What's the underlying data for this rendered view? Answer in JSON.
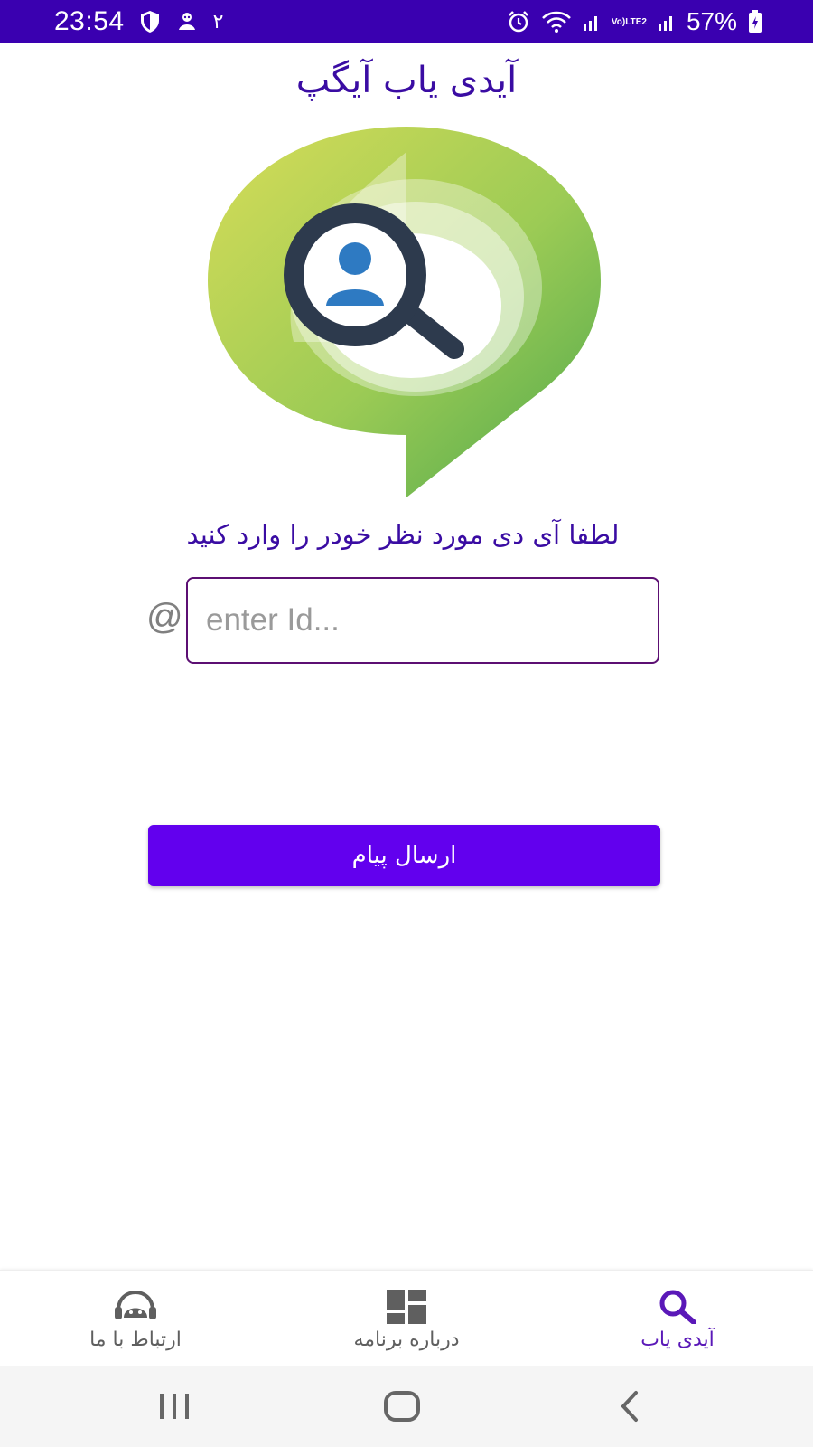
{
  "status_bar": {
    "time": "23:54",
    "extra_indicator": "۲",
    "battery": "57%",
    "network": "LTE2",
    "background_color": "#3a00b0"
  },
  "app": {
    "title": "آیدی یاب آیگپ",
    "prompt": "لطفا آی دی مورد نظر خودر را وارد کنید"
  },
  "form": {
    "prefix": "@",
    "placeholder": "enter Id...",
    "value": "",
    "submit_label": "ارسال پیام",
    "accent_color": "#6200ee"
  },
  "bottom_nav": {
    "items": [
      {
        "label": "ارتباط با ما",
        "icon": "support-headset-icon",
        "active": false
      },
      {
        "label": "درباره برنامه",
        "icon": "dashboard-icon",
        "active": false
      },
      {
        "label": "آیدی یاب",
        "icon": "search-icon",
        "active": true
      }
    ]
  },
  "system_nav": {
    "buttons": [
      "recent-apps-icon",
      "home-icon",
      "back-icon"
    ]
  }
}
